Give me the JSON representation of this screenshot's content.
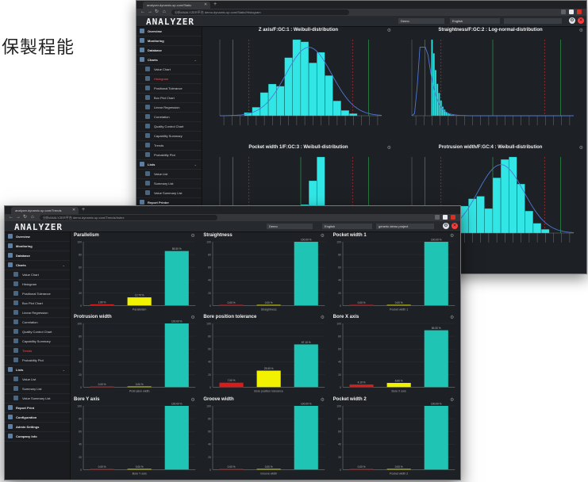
{
  "caption": "保製程能",
  "back_window": {
    "browser": {
      "tab_title": "analyzer.dynamic-sp.com/Static",
      "url": "分析ANALYZER平台   demo.dynamic-sp.com/Static/Histogram"
    },
    "logo": "ANALYZER",
    "header": {
      "select1": "Demo",
      "select2": "English"
    },
    "sidebar": [
      {
        "label": "Overview",
        "sub": false
      },
      {
        "label": "Monitoring",
        "sub": false
      },
      {
        "label": "Database",
        "sub": false
      },
      {
        "label": "Charts",
        "sub": false,
        "chev": "v"
      },
      {
        "label": "Value Chart",
        "sub": true
      },
      {
        "label": "Histogram",
        "sub": true,
        "active": true
      },
      {
        "label": "Positional Tolerance",
        "sub": true
      },
      {
        "label": "Box Plot Chart",
        "sub": true
      },
      {
        "label": "Linear Regression",
        "sub": true
      },
      {
        "label": "Correlation",
        "sub": true
      },
      {
        "label": "Quality Control Chart",
        "sub": true
      },
      {
        "label": "Capability Summary",
        "sub": true
      },
      {
        "label": "Trends",
        "sub": true
      },
      {
        "label": "Probability Plot",
        "sub": true
      },
      {
        "label": "Lists",
        "sub": false,
        "chev": "v"
      },
      {
        "label": "Value List",
        "sub": true
      },
      {
        "label": "Summary List",
        "sub": true
      },
      {
        "label": "Value Summary List",
        "sub": true
      },
      {
        "label": "Report Printer",
        "sub": false
      }
    ],
    "charts": [
      {
        "title": "Z axis/F:GC:1 : Weibull-distribution",
        "bars": [
          3,
          8,
          22,
          30,
          28,
          55,
          72,
          70,
          50,
          60,
          38,
          14,
          5,
          2
        ],
        "curve": "weibull"
      },
      {
        "title": "Straightness/F:GC:2 : Log-normal-distribution",
        "bars": [
          100,
          82,
          60,
          42,
          30,
          20,
          12,
          8,
          5,
          3,
          2,
          1,
          1,
          0,
          0,
          0,
          0,
          0,
          0,
          0
        ],
        "curve": "lognormal"
      },
      {
        "title": "Pocket width 1/F:GC:3 : Weibull-distribution",
        "bars": [
          0,
          0,
          0,
          0,
          2,
          4,
          10,
          30,
          55,
          80,
          12,
          0,
          0,
          0
        ],
        "curve": "none"
      },
      {
        "title": "Protrusion width/F:GC:4 : Weibull-distribution",
        "bars": [
          2,
          5,
          10,
          22,
          28,
          30,
          20,
          45,
          60,
          62,
          40,
          18,
          8,
          3
        ],
        "curve": "weibull"
      }
    ]
  },
  "front_window": {
    "browser": {
      "tab_title": "analyzer.dynamic-sp.com/Trends",
      "url": "分析ANALYZER平台   demo.dynamic-sp.com/Trends/Index"
    },
    "logo": "ANALYZER",
    "header": {
      "select1": "Demo",
      "select2": "English",
      "select3": "generic demo project"
    },
    "sidebar": [
      {
        "label": "Overview",
        "sub": false
      },
      {
        "label": "Monitoring",
        "sub": false
      },
      {
        "label": "Database",
        "sub": false
      },
      {
        "label": "Charts",
        "sub": false,
        "chev": "v"
      },
      {
        "label": "Value Chart",
        "sub": true
      },
      {
        "label": "Histogram",
        "sub": true
      },
      {
        "label": "Positional Tolerance",
        "sub": true
      },
      {
        "label": "Box Plot Chart",
        "sub": true
      },
      {
        "label": "Linear Regression",
        "sub": true
      },
      {
        "label": "Correlation",
        "sub": true
      },
      {
        "label": "Quality Control Chart",
        "sub": true
      },
      {
        "label": "Capability Summary",
        "sub": true
      },
      {
        "label": "Trends",
        "sub": true,
        "active": true
      },
      {
        "label": "Probability Plot",
        "sub": true
      },
      {
        "label": "Lists",
        "sub": false,
        "chev": "v"
      },
      {
        "label": "Value List",
        "sub": true
      },
      {
        "label": "Summary List",
        "sub": true
      },
      {
        "label": "Value Summary List",
        "sub": true
      },
      {
        "label": "Report Print",
        "sub": false
      },
      {
        "label": "Configuration",
        "sub": false
      },
      {
        "label": "Admin Settings",
        "sub": false
      },
      {
        "label": "Company Info",
        "sub": false
      }
    ],
    "charts": [
      {
        "title": "Parallelism",
        "xlabel": "Parallelism",
        "values": [
          1.8,
          12.7,
          85.5
        ]
      },
      {
        "title": "Straightness",
        "xlabel": "Straightness",
        "values": [
          0,
          0,
          100
        ]
      },
      {
        "title": "Pocket width 1",
        "xlabel": "Pocket width 1",
        "values": [
          0,
          0,
          100
        ]
      },
      {
        "title": "Protrusion width",
        "xlabel": "Protrusion width",
        "values": [
          0.0,
          0.0,
          100.0
        ]
      },
      {
        "title": "Bore position tolerance",
        "xlabel": "Bore position tolerance",
        "values": [
          7.0,
          25.9,
          67.1
        ]
      },
      {
        "title": "Bore X axis",
        "xlabel": "Bore X axis",
        "values": [
          4.1,
          6.6,
          89.3
        ]
      },
      {
        "title": "Bore Y axis",
        "xlabel": "Bore Y axis",
        "values": [
          0.0,
          0.0,
          100.0
        ]
      },
      {
        "title": "Groove width",
        "xlabel": "Groove width",
        "values": [
          0,
          0,
          100
        ]
      },
      {
        "title": "Pocket width 2",
        "xlabel": "Pocket width 2",
        "values": [
          0,
          0,
          100
        ]
      }
    ],
    "colors": {
      "bad": "#d81b1b",
      "warn": "#f2f200",
      "good": "#1fc4b4"
    }
  }
}
